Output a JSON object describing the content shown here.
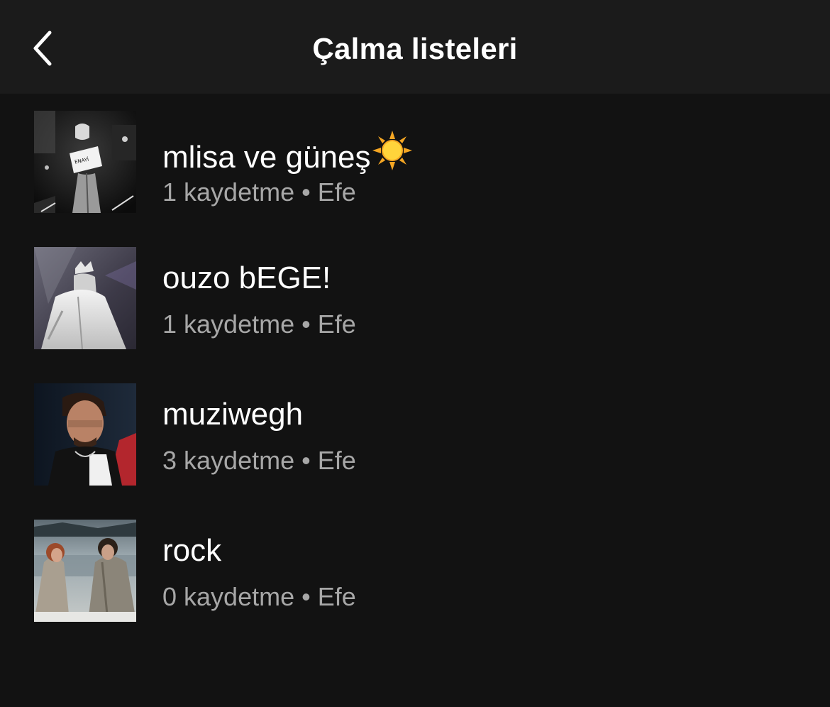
{
  "header": {
    "title": "Çalma listeleri",
    "back_icon": "chevron-left-icon"
  },
  "colors": {
    "background": "#121212",
    "header_background": "#1b1b1b",
    "title_text": "#ffffff",
    "meta_text": "#a7a7a7"
  },
  "playlists": [
    {
      "title": "mlisa ve güneş",
      "title_icon": "sun-emoji-icon",
      "meta": "1 kaydetme • Efe",
      "cover": "concert-protest-sign-photo"
    },
    {
      "title": "ouzo bEGE!",
      "meta": "1 kaydetme • Efe",
      "cover": "stage-performer-photo"
    },
    {
      "title": "muziwegh",
      "meta": "3 kaydetme • Efe",
      "cover": "portrait-photo"
    },
    {
      "title": "rock",
      "meta": "0 kaydetme • Efe",
      "cover": "snowy-couple-photo"
    }
  ]
}
